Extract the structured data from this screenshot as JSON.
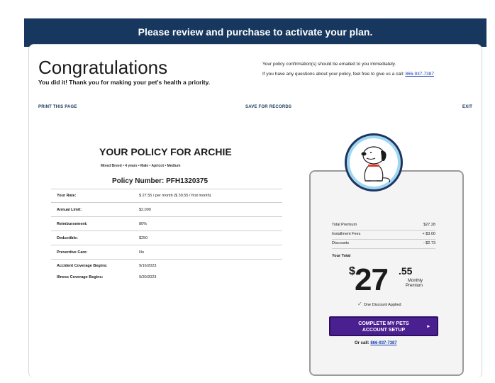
{
  "banner": {
    "text": "Please review and purchase to activate your plan."
  },
  "header": {
    "title": "Congratulations",
    "subtitle": "You did it! Thank you for making your pet's health a priority.",
    "confirmation_text": "Your policy confirmation(s) should be emailed to you immediately.",
    "questions_text": "If you have any questions about your policy, feel free to give us a call: ",
    "phone_link": "866-937-7387"
  },
  "actions": {
    "print": "PRINT THIS PAGE",
    "save": "SAVE FOR RECORDS",
    "exit": "EXIT"
  },
  "policy": {
    "title": "YOUR POLICY FOR ARCHIE",
    "pet_details": "Mixed Breed • 4 years • Male • Apricot • Medium",
    "policy_number": "Policy Number: PFH1320375",
    "rows": [
      {
        "label": "Your Rate:",
        "value": "$ 27.55 / per month ($ 39.55 / first month)"
      },
      {
        "label": "Annual Limit:",
        "value": "$2,000"
      },
      {
        "label": "Reimbursement:",
        "value": "80%"
      },
      {
        "label": "Deductible:",
        "value": "$250"
      },
      {
        "label": "Preventive Care:",
        "value": "No"
      },
      {
        "label": "Accident Coverage Begins:",
        "value": "9/16/2023"
      },
      {
        "label": "Illness Coverage Begins:",
        "value": "9/30/2023"
      }
    ]
  },
  "summary": {
    "fees": [
      {
        "label": "Total Premium",
        "value": "$27.28"
      },
      {
        "label": "Installment Fees",
        "value": "+ $3.00"
      },
      {
        "label": "Discounts",
        "value": "- $2.73"
      }
    ],
    "total_label": "Your Total",
    "currency": "$",
    "amount_whole": "27",
    "amount_cents": ".55",
    "period": "Monthly Premium",
    "discount_note": "One Discount Applied",
    "cta_line1": "COMPLETE MY PETS",
    "cta_line2": "ACCOUNT SETUP",
    "or_call": "Or call: ",
    "phone": "866-937-7387"
  },
  "colors": {
    "navy": "#17375e",
    "purple": "#4a1f8f",
    "link": "#1a3fb3",
    "check": "#2e8b3a",
    "snoopy_ring": "#9fd7f2"
  },
  "icons": {
    "mascot": "snoopy-illustration",
    "check": "check-icon",
    "arrow": "chevron-right-icon"
  }
}
